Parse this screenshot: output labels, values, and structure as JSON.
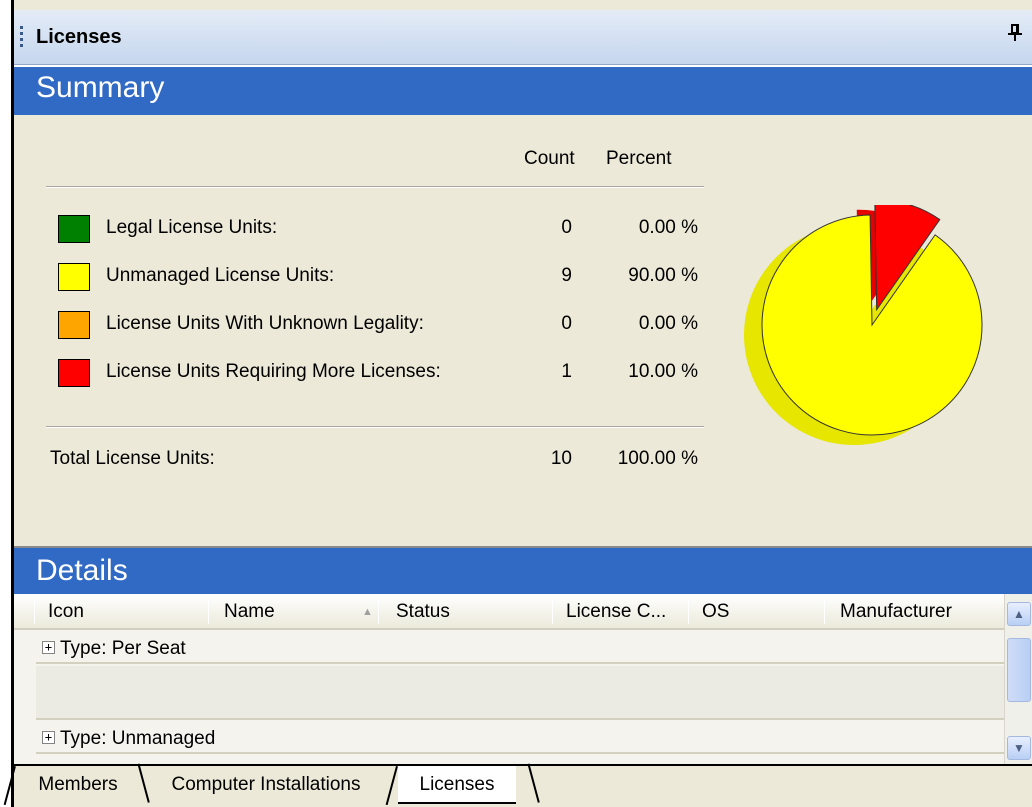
{
  "window": {
    "title": "Licenses",
    "pin_glyph": "ꟼ"
  },
  "summary": {
    "header": "Summary",
    "columns": {
      "count": "Count",
      "percent": "Percent"
    },
    "rows": [
      {
        "label": "Legal License Units:",
        "count": "0",
        "percent": "0.00 %",
        "color": "#008000"
      },
      {
        "label": "Unmanaged License Units:",
        "count": "9",
        "percent": "90.00 %",
        "color": "#ffff00"
      },
      {
        "label": "License Units With Unknown Legality:",
        "count": "0",
        "percent": "0.00 %",
        "color": "#ffa500"
      },
      {
        "label": "License Units Requiring More Licenses:",
        "count": "1",
        "percent": "10.00 %",
        "color": "#ff0000"
      }
    ],
    "total": {
      "label": "Total License Units:",
      "count": "10",
      "percent": "100.00 %"
    }
  },
  "chart_data": {
    "type": "pie",
    "categories": [
      "Legal License Units",
      "Unmanaged License Units",
      "License Units With Unknown Legality",
      "License Units Requiring More Licenses"
    ],
    "values": [
      0,
      9,
      0,
      1
    ],
    "colors": [
      "#008000",
      "#ffff00",
      "#ffa500",
      "#ff0000"
    ]
  },
  "details": {
    "header": "Details",
    "columns": [
      "Icon",
      "Name",
      "Status",
      "License C...",
      "OS",
      "Manufacturer"
    ],
    "sort_glyph": "▲",
    "rows": [
      {
        "expander": "+",
        "text": "Type: Per Seat"
      },
      {
        "expander": "",
        "text": ""
      },
      {
        "expander": "+",
        "text": "Type: Unmanaged"
      }
    ],
    "scroll_up_glyph": "▲",
    "scroll_down_glyph": "▼"
  },
  "tabs": [
    {
      "label": "Members",
      "active": false
    },
    {
      "label": "Computer Installations",
      "active": false
    },
    {
      "label": "Licenses",
      "active": true
    }
  ]
}
